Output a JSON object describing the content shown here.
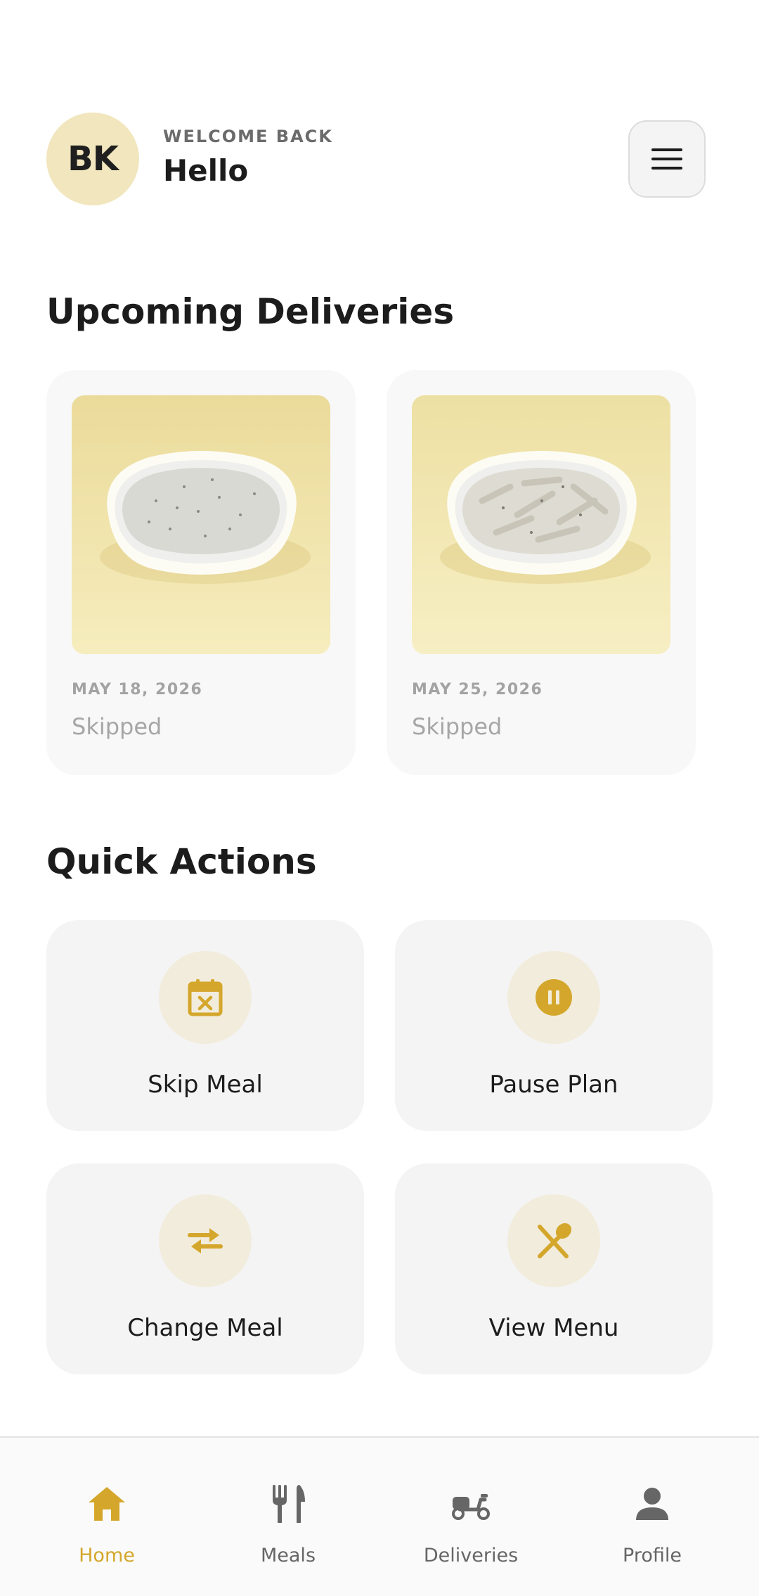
{
  "colors": {
    "accent": "#D4A72C",
    "avatar_bg": "#F1E6BD",
    "card_bg": "#F4F4F4",
    "muted": "#A3A3A3"
  },
  "header": {
    "avatar_initials": "BK",
    "welcome": "WELCOME BACK",
    "greeting": "Hello",
    "menu_icon": "hamburger-menu-icon"
  },
  "deliveries": {
    "title": "Upcoming Deliveries",
    "items": [
      {
        "date": "MAY 18, 2026",
        "status": "Skipped",
        "image": "creamy-risotto-bowl"
      },
      {
        "date": "MAY 25, 2026",
        "status": "Skipped",
        "image": "creamy-penne-bowl"
      }
    ]
  },
  "quick_actions": {
    "title": "Quick Actions",
    "items": [
      {
        "label": "Skip Meal",
        "icon": "calendar-x-icon"
      },
      {
        "label": "Pause Plan",
        "icon": "pause-circle-icon"
      },
      {
        "label": "Change Meal",
        "icon": "swap-arrows-icon"
      },
      {
        "label": "View Menu",
        "icon": "utensils-cross-icon"
      }
    ]
  },
  "nav": {
    "items": [
      {
        "label": "Home",
        "icon": "home-icon",
        "active": true
      },
      {
        "label": "Meals",
        "icon": "fork-knife-icon",
        "active": false
      },
      {
        "label": "Deliveries",
        "icon": "scooter-icon",
        "active": false
      },
      {
        "label": "Profile",
        "icon": "person-icon",
        "active": false
      }
    ]
  }
}
